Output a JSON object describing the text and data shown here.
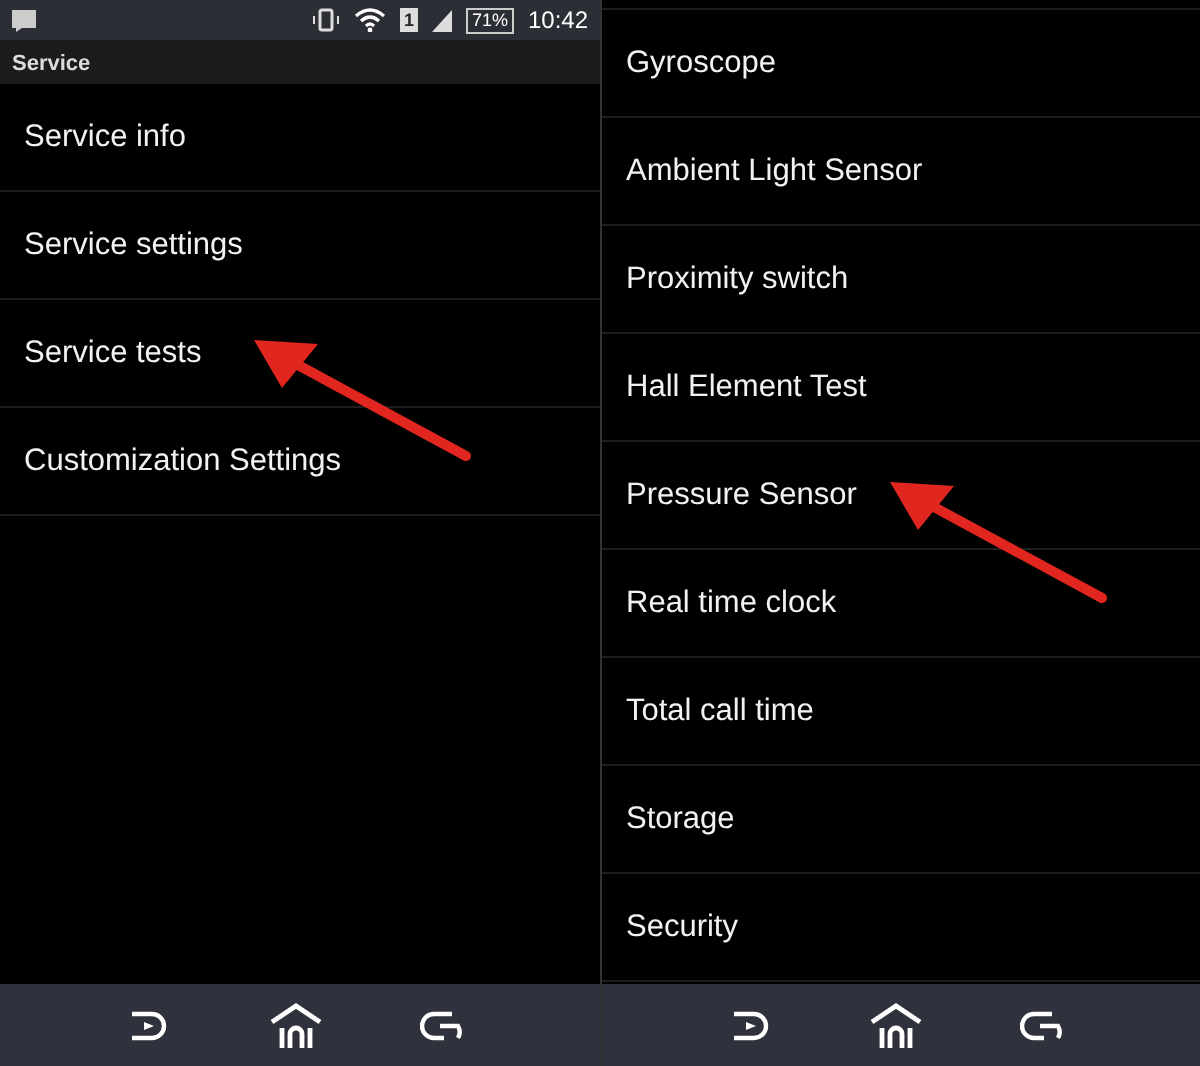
{
  "screens": [
    {
      "status_bar": {
        "sim": "1",
        "battery": "71%",
        "time": "10:42"
      },
      "title": "Service",
      "items": [
        {
          "label": "Service info",
          "pointed": false
        },
        {
          "label": "Service settings",
          "pointed": false
        },
        {
          "label": "Service tests",
          "pointed": true
        },
        {
          "label": "Customization Settings",
          "pointed": false
        }
      ]
    },
    {
      "items": [
        {
          "label": "Gyroscope",
          "pointed": false
        },
        {
          "label": "Ambient Light Sensor",
          "pointed": false
        },
        {
          "label": "Proximity switch",
          "pointed": false
        },
        {
          "label": "Hall Element Test",
          "pointed": false
        },
        {
          "label": "Pressure Sensor",
          "pointed": true
        },
        {
          "label": "Real time clock",
          "pointed": false
        },
        {
          "label": "Total call time",
          "pointed": false
        },
        {
          "label": "Storage",
          "pointed": false
        },
        {
          "label": "Security",
          "pointed": false
        }
      ]
    }
  ]
}
